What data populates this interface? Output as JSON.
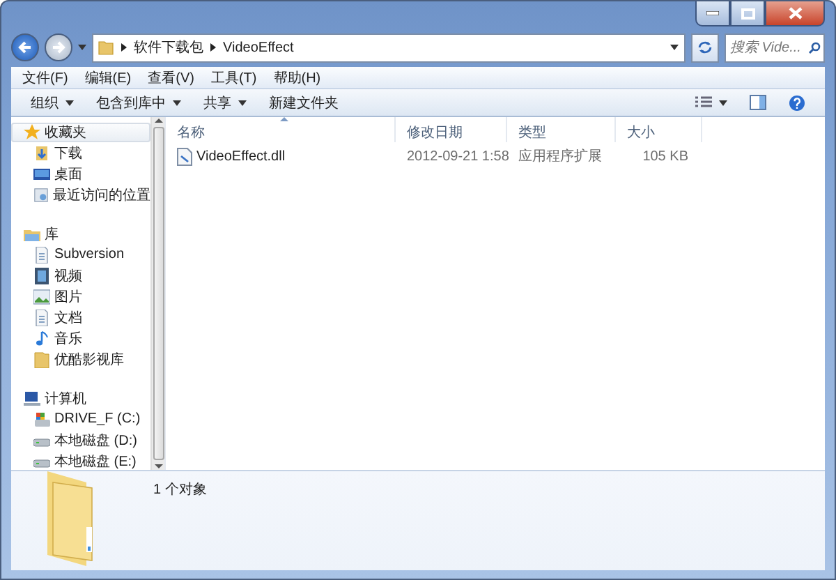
{
  "address": {
    "crumbs": [
      "软件下载包",
      "VideoEffect"
    ]
  },
  "search": {
    "placeholder": "搜索 Vide..."
  },
  "menu": [
    "文件(F)",
    "编辑(E)",
    "查看(V)",
    "工具(T)",
    "帮助(H)"
  ],
  "commands": [
    {
      "label": "组织",
      "dropdown": true
    },
    {
      "label": "包含到库中",
      "dropdown": true
    },
    {
      "label": "共享",
      "dropdown": true
    },
    {
      "label": "新建文件夹",
      "dropdown": false
    }
  ],
  "sidebar": {
    "groups": [
      {
        "label": "收藏夹",
        "selected": true,
        "children": [
          {
            "label": "下载"
          },
          {
            "label": "桌面"
          },
          {
            "label": "最近访问的位置"
          }
        ]
      },
      {
        "label": "库",
        "selected": false,
        "children": [
          {
            "label": "Subversion"
          },
          {
            "label": "视频"
          },
          {
            "label": "图片"
          },
          {
            "label": "文档"
          },
          {
            "label": "音乐"
          },
          {
            "label": "优酷影视库"
          }
        ]
      },
      {
        "label": "计算机",
        "selected": false,
        "children": [
          {
            "label": "DRIVE_F (C:)"
          },
          {
            "label": "本地磁盘 (D:)"
          },
          {
            "label": "本地磁盘 (E:)"
          }
        ]
      }
    ]
  },
  "table": {
    "columns": [
      "名称",
      "修改日期",
      "类型",
      "大小"
    ],
    "rows": [
      {
        "cells": [
          "VideoEffect.dll",
          "2012-09-21 1:58",
          "应用程序扩展",
          "105 KB"
        ]
      }
    ]
  },
  "status": {
    "text": "1 个对象"
  }
}
